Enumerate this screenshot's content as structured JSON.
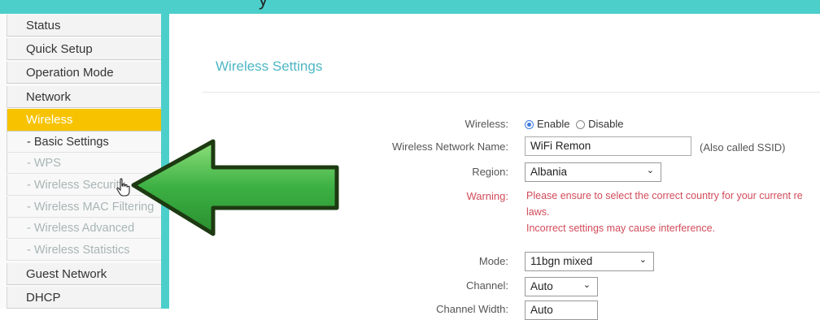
{
  "top_fragment": "y",
  "sidebar": {
    "items": [
      {
        "label": "Status"
      },
      {
        "label": "Quick Setup"
      },
      {
        "label": "Operation Mode"
      },
      {
        "label": "Network"
      },
      {
        "label": "Wireless"
      }
    ],
    "sub_items": [
      {
        "label": "- Basic Settings"
      },
      {
        "label": "- WPS"
      },
      {
        "label": "- Wireless Security"
      },
      {
        "label": "- Wireless MAC Filtering"
      },
      {
        "label": "- Wireless Advanced"
      },
      {
        "label": "- Wireless Statistics"
      }
    ],
    "bottom_items": [
      {
        "label": "Guest Network"
      },
      {
        "label": "DHCP"
      }
    ]
  },
  "main": {
    "title": "Wireless Settings",
    "wireless_label": "Wireless:",
    "enable_label": "Enable",
    "disable_label": "Disable",
    "network_name_label": "Wireless Network Name:",
    "network_name_value": "WiFi Remon",
    "ssid_hint": "(Also called SSID)",
    "region_label": "Region:",
    "region_value": "Albania",
    "warning_label": "Warning:",
    "warning_line1": "Please ensure to select the correct country for your current re",
    "warning_line2": "laws.",
    "warning_line3": "Incorrect settings may cause interference.",
    "mode_label": "Mode:",
    "mode_value": "11bgn mixed",
    "channel_label": "Channel:",
    "channel_value": "Auto",
    "channel_width_label": "Channel Width:",
    "channel_width_value": "Auto"
  },
  "colors": {
    "accent": "#4ccfcb",
    "active_menu": "#f7c300",
    "title": "#4eb7c4",
    "warning": "#d24b5a",
    "arrow": "#3cb043"
  }
}
